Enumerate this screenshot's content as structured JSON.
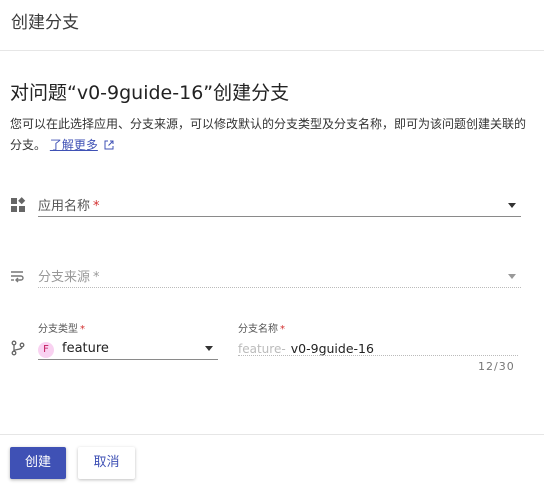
{
  "header": {
    "title": "创建分支"
  },
  "main": {
    "title": "对问题“v0-9guide-16”创建分支",
    "description": "您可以在此选择应用、分支来源，可以修改默认的分支类型及分支名称，即可为该问题创建关联的分支。",
    "learn_more": "了解更多"
  },
  "form": {
    "app_name": {
      "label": "应用名称",
      "required": "*"
    },
    "branch_source": {
      "label": "分支来源",
      "required": "*"
    },
    "branch_type": {
      "label": "分支类型",
      "required": "*",
      "badge": "F",
      "value": "feature"
    },
    "branch_name": {
      "label": "分支名称",
      "required": "*",
      "prefix": "feature-",
      "value": "v0-9guide-16",
      "counter": "12/30"
    }
  },
  "footer": {
    "create_label": "创建",
    "cancel_label": "取消"
  }
}
